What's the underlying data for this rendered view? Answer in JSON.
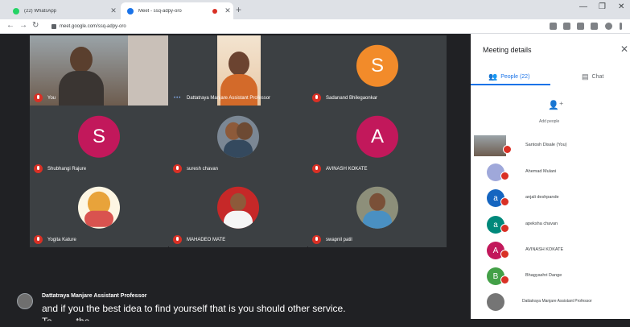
{
  "browser": {
    "tabs": [
      {
        "title": "(22) WhatsApp",
        "favicon_color": "#25d366"
      },
      {
        "title": "Meet - ssq-adpy-oro",
        "favicon_color": "#1a73e8"
      }
    ],
    "new_tab": "+",
    "url": "meet.google.com/ssq-adpy-oro"
  },
  "meeting": {
    "tiles": [
      {
        "name": "You",
        "type": "video"
      },
      {
        "name": "Dattatraya Manjare Assistant Professor",
        "type": "video"
      },
      {
        "name": "Sadanand Bhilegaonkar",
        "type": "letter",
        "letter": "S",
        "color": "#f28b2a"
      },
      {
        "name": "Shubhangi Rajure",
        "type": "letter",
        "letter": "S",
        "color": "#c2185b"
      },
      {
        "name": "suresh chavan",
        "type": "photo"
      },
      {
        "name": "AVINASH KOKATE",
        "type": "letter",
        "letter": "A",
        "color": "#c2185b"
      },
      {
        "name": "Yogita Kature",
        "type": "photo"
      },
      {
        "name": "MAHADEO MATE",
        "type": "photo"
      },
      {
        "name": "swapnil patil",
        "type": "photo"
      }
    ],
    "caption": {
      "speaker": "Dattatraya Manjare Assistant Professor",
      "text": "and if you the best idea to find yourself that is you should other service.",
      "text_partial": "To ... ... the ... ... ..."
    }
  },
  "panel": {
    "title": "Meeting details",
    "tabs": {
      "people": "People (22)",
      "chat": "Chat"
    },
    "add_people": "Add people",
    "participants": [
      {
        "name": "Santosh Disale (You)",
        "avatar": "photo"
      },
      {
        "name": "Ahemad Mulani",
        "avatar": "photo"
      },
      {
        "name": "anjali deshpande",
        "avatar": "letter",
        "letter": "a",
        "color": "#1565c0"
      },
      {
        "name": "apeksha chavan",
        "avatar": "letter",
        "letter": "a",
        "color": "#00897b"
      },
      {
        "name": "AVINASH KOKATE",
        "avatar": "letter",
        "letter": "A",
        "color": "#c2185b"
      },
      {
        "name": "Bhagyashri Dange",
        "avatar": "letter",
        "letter": "B",
        "color": "#43a047"
      },
      {
        "name": "Dattatraya Manjare Assistant Professor",
        "avatar": "photo"
      }
    ]
  }
}
